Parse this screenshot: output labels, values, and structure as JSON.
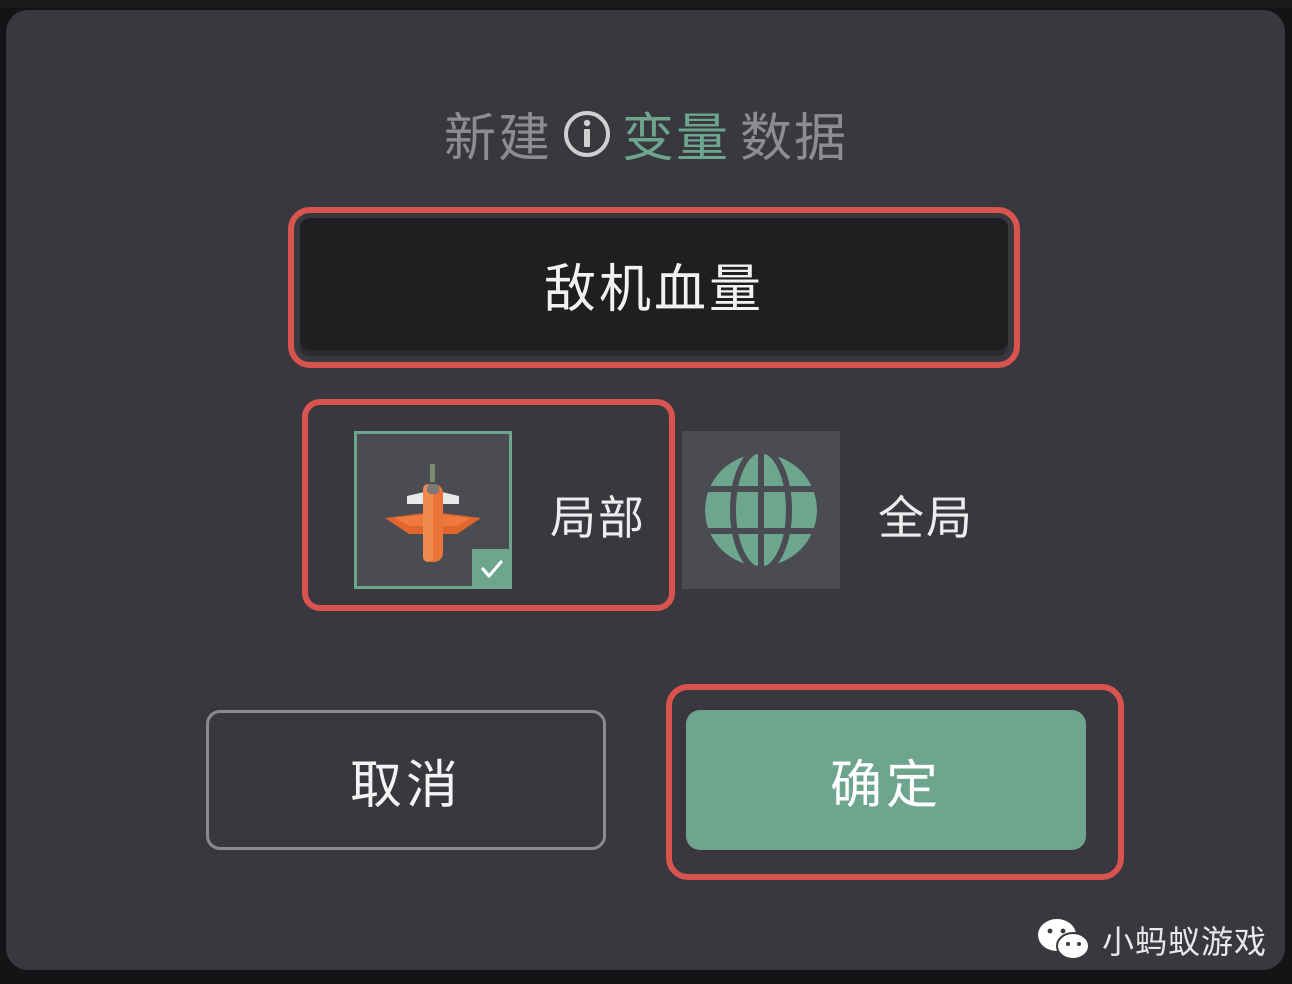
{
  "dialog": {
    "title_prefix": "新建",
    "title_accent": "变量",
    "title_suffix": "数据",
    "name_input_value": "敌机血量",
    "scope_local_label": "局部",
    "scope_global_label": "全局",
    "scope_selected": "局部",
    "cancel_label": "取消",
    "confirm_label": "确定"
  },
  "watermark": {
    "text": "小蚂蚁游戏",
    "icon": "wechat-icon"
  },
  "icons": {
    "info": "info-icon",
    "local_scope": "plane-icon",
    "global_scope": "globe-icon",
    "check": "check-icon"
  },
  "colors": {
    "accent": "#6da58e",
    "highlight": "#d9534f",
    "panel": "#38383e",
    "input_bg": "#1f1f22"
  }
}
